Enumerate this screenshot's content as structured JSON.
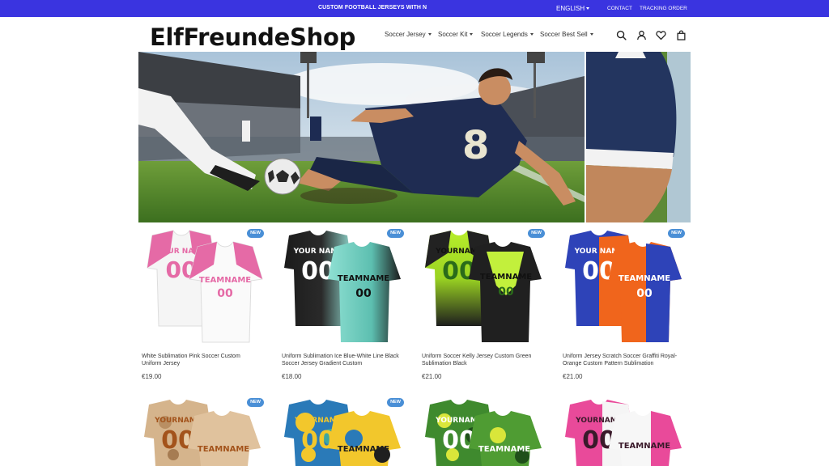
{
  "topbar": {
    "promo": "CUSTOM FOOTBALL JERSEYS WITH N",
    "language": "ENGLISH",
    "links": [
      "CONTACT",
      "TRACKING ORDER"
    ]
  },
  "header": {
    "logo": "ElfFreundeShop",
    "nav": [
      "Soccer Jersey",
      "Soccer Kit",
      "Soccer Legends",
      "Soccer Best Sell"
    ],
    "icons": [
      "search-icon",
      "account-icon",
      "wishlist-icon",
      "cart-icon"
    ]
  },
  "colors": {
    "topbar": "#3a34e0",
    "badge": "#4a8fd6"
  },
  "products": [
    {
      "badge": "NEW",
      "title_line1": "White Sublimation Pink Soccer Custom",
      "title_line2": "Uniform Jersey",
      "price": "€19.00",
      "front_name": "YOUR NAME",
      "back_name": "TEAMNAME",
      "number": "00"
    },
    {
      "badge": "NEW",
      "title_line1": "Uniform Sublimation Ice Blue-White Line Black",
      "title_line2": "Soccer Jersey Gradient Custom",
      "price": "€18.00",
      "front_name": "YOUR NAME",
      "back_name": "TEAMNAME",
      "number": "00"
    },
    {
      "badge": "NEW",
      "title_line1": "Uniform Soccer Kelly Jersey Custom Green",
      "title_line2": "Sublimation Black",
      "price": "€21.00",
      "front_name": "YOURNAME",
      "back_name": "TEAMNAME",
      "number": "00"
    },
    {
      "badge": "NEW",
      "title_line1": "Uniform Jersey Scratch Soccer Graffiti Royal-",
      "title_line2": "Orange Custom Pattern Sublimation",
      "price": "€21.00",
      "front_name": "YOUR NAME",
      "back_name": "TEAMNAME",
      "number": "00"
    }
  ],
  "products_row2": [
    {
      "badge": "NEW",
      "front_name": "YOURNAME",
      "back_name": "TEAMNAME",
      "number": "00"
    },
    {
      "badge": "NEW",
      "front_name": "YOURNAME",
      "back_name": "TEAMNAME",
      "number": "00"
    },
    {
      "front_name": "YOURNAME",
      "back_name": "TEAMNAME",
      "number": "00"
    },
    {
      "front_name": "YOURNAME",
      "back_name": "TEAMNAME",
      "number": "00"
    }
  ]
}
